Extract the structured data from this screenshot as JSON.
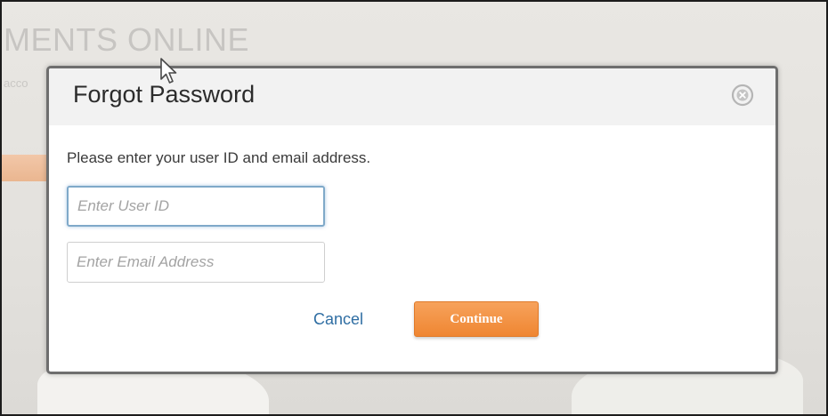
{
  "background": {
    "heading": "MENTS ONLINE",
    "subtext": "acco"
  },
  "modal": {
    "title": "Forgot Password",
    "instructions": "Please enter your user ID and email address.",
    "user_id_input": {
      "value": "",
      "placeholder": "Enter User ID"
    },
    "email_input": {
      "value": "",
      "placeholder": "Enter Email Address"
    },
    "cancel_label": "Cancel",
    "continue_label": "Continue",
    "close_icon": "close-circle-icon"
  },
  "colors": {
    "accent_button": "#ef8632",
    "link": "#2f6ea3",
    "focus_border": "#7fa9c9"
  }
}
